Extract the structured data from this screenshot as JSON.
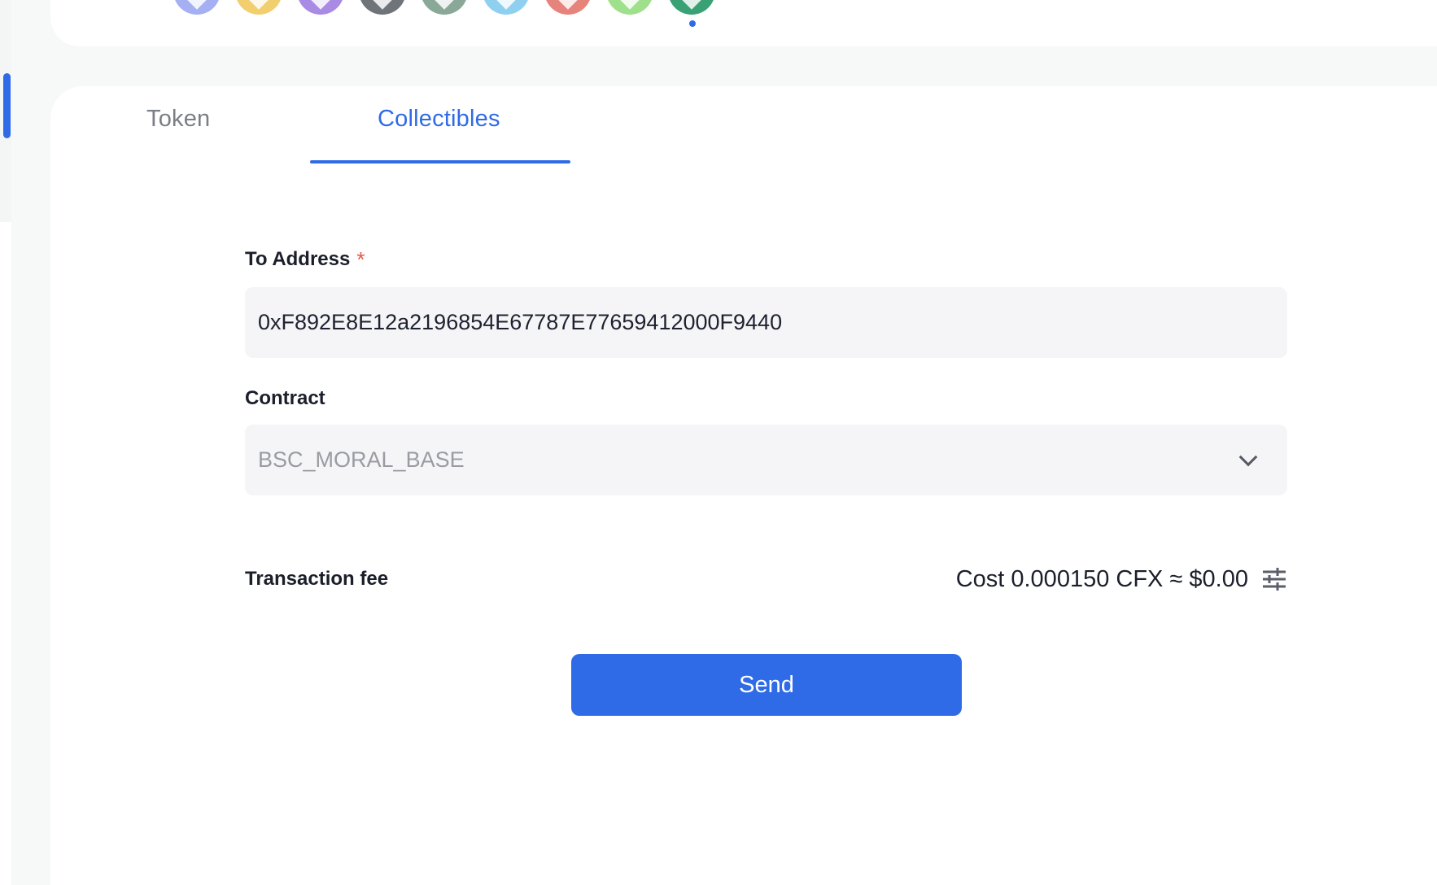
{
  "chains": [
    {
      "icon": "ethereum-icon",
      "color": "#a4b0f2"
    },
    {
      "icon": "binance-icon",
      "color": "#f2cf6e"
    },
    {
      "icon": "polygon-icon",
      "color": "#a98be6"
    },
    {
      "icon": "arbitrum-icon",
      "color": "#6f747b"
    },
    {
      "icon": "chain-ring-icon",
      "color": "#8aa898"
    },
    {
      "icon": "chain-cube-icon",
      "color": "#8fd0f0"
    },
    {
      "icon": "chain-red-icon",
      "color": "#e6847c"
    },
    {
      "icon": "chain-green-icon",
      "color": "#9fe08c"
    },
    {
      "icon": "conflux-icon",
      "color": "#3aa174"
    }
  ],
  "tabs": {
    "token": "Token",
    "collectibles": "Collectibles",
    "active": "collectibles"
  },
  "form": {
    "to_address_label": "To Address",
    "required_mark": "*",
    "to_address_value": "0xF892E8E12a2196854E67787E77659412000F9440",
    "contract_label": "Contract",
    "contract_value": "BSC_MORAL_BASE"
  },
  "fee": {
    "label": "Transaction fee",
    "value": "Cost 0.000150 CFX ≈ $0.00"
  },
  "send_label": "Send",
  "colors": {
    "accent": "#2f6be6",
    "required": "#e5574b"
  }
}
